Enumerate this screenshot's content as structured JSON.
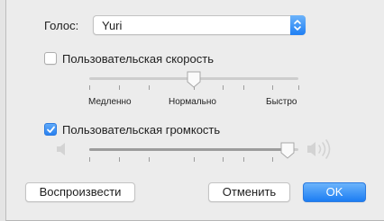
{
  "voice": {
    "label": "Голос:",
    "value": "Yuri"
  },
  "rate": {
    "checkbox_label": "Пользовательская скорость",
    "checked": false,
    "slow_label": "Медленно",
    "normal_label": "Нормально",
    "fast_label": "Быстро",
    "position": 0.5
  },
  "volume": {
    "checkbox_label": "Пользовательская громкость",
    "checked": true,
    "level": 0.95,
    "low_icon": "speaker-low-icon",
    "high_icon": "speaker-high-icon"
  },
  "buttons": {
    "play": "Воспроизвести",
    "cancel": "Отменить",
    "ok": "OK"
  },
  "colors": {
    "accent": "#1f7ff4",
    "sheet_bg": "#ececec"
  }
}
